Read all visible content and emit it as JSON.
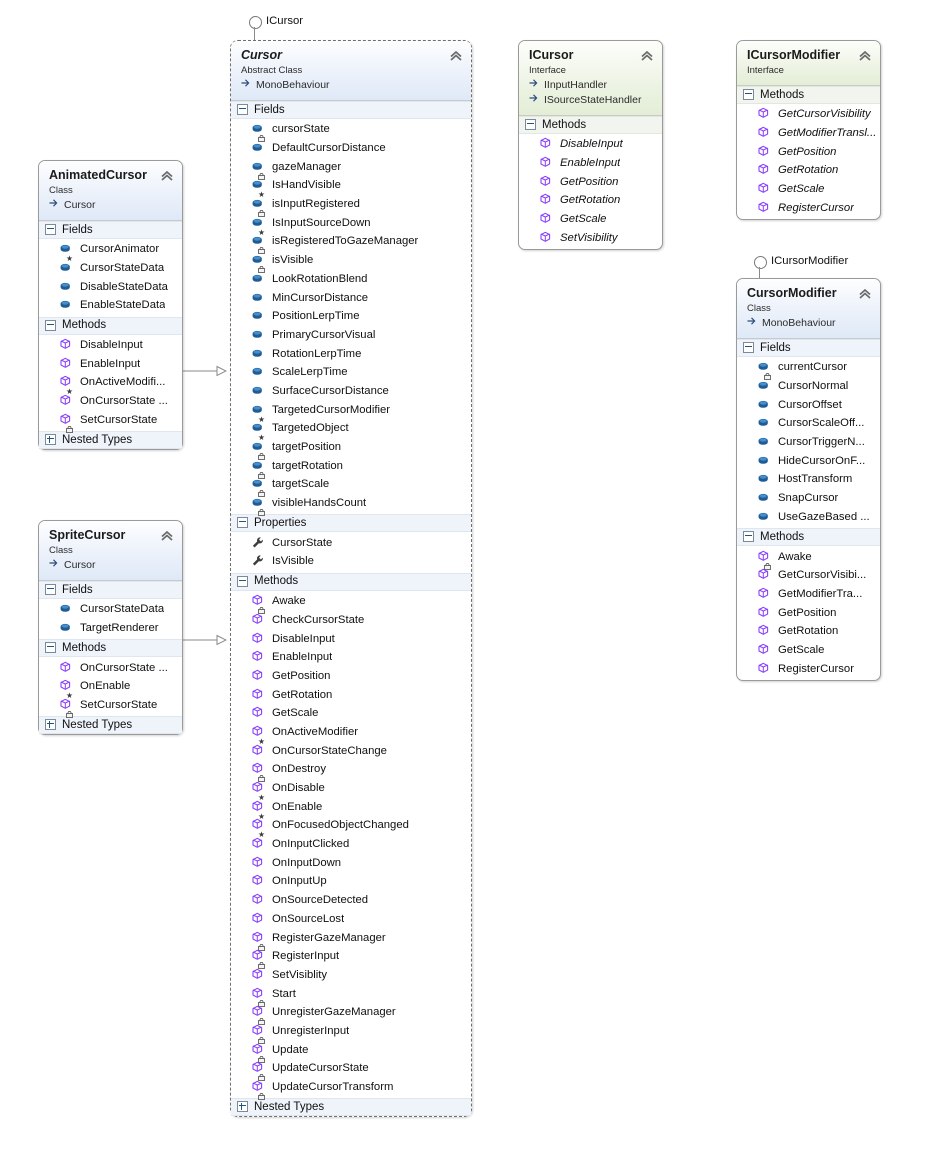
{
  "diagram": {
    "title": "Class Diagram",
    "icons": {
      "collapse": "chevron-up-icon",
      "expand_section": "plus-box-icon",
      "collapse_section": "minus-box-icon",
      "field": "field-icon",
      "property": "property-wrench-icon",
      "method": "method-cube-icon",
      "private": "lock-badge",
      "protected": "key-badge",
      "interface_lollipop": "lollipop-icon",
      "inheritance_arrow": "hollow-triangle-arrow"
    },
    "colors": {
      "class_header": "#dfe9f7",
      "interface_header": "#e3eed6",
      "section_row": "#eff3fa",
      "field_icon": "#2e75b6",
      "method_icon": "#8a3ffc",
      "property_icon": "#3d3d3d",
      "connector": "#8a8a8a",
      "border": "#9a9a9a"
    }
  },
  "lollipops": [
    {
      "label": "ICursor",
      "target": "Cursor"
    },
    {
      "label": "ICursorModifier",
      "target": "CursorModifier"
    }
  ],
  "classes": {
    "animated_cursor": {
      "name": "AnimatedCursor",
      "kind": "Class",
      "base": "Cursor",
      "abstract": false,
      "sections": [
        {
          "label": "Fields",
          "expanded": true,
          "members": [
            {
              "name": "CursorAnimator",
              "icon": "field",
              "modifier": "protected"
            },
            {
              "name": "CursorStateData",
              "icon": "field",
              "modifier": "public"
            },
            {
              "name": "DisableStateData",
              "icon": "field",
              "modifier": "public"
            },
            {
              "name": "EnableStateData",
              "icon": "field",
              "modifier": "public"
            }
          ]
        },
        {
          "label": "Methods",
          "expanded": true,
          "members": [
            {
              "name": "DisableInput",
              "icon": "method",
              "modifier": "public"
            },
            {
              "name": "EnableInput",
              "icon": "method",
              "modifier": "public"
            },
            {
              "name": "OnActiveModifi...",
              "icon": "method",
              "modifier": "protected"
            },
            {
              "name": "OnCursorState ...",
              "icon": "method",
              "modifier": "public"
            },
            {
              "name": "SetCursorState",
              "icon": "method",
              "modifier": "private"
            }
          ]
        },
        {
          "label": "Nested Types",
          "expanded": false,
          "members": []
        }
      ]
    },
    "sprite_cursor": {
      "name": "SpriteCursor",
      "kind": "Class",
      "base": "Cursor",
      "abstract": false,
      "sections": [
        {
          "label": "Fields",
          "expanded": true,
          "members": [
            {
              "name": "CursorStateData",
              "icon": "field",
              "modifier": "public"
            },
            {
              "name": "TargetRenderer",
              "icon": "field",
              "modifier": "public"
            }
          ]
        },
        {
          "label": "Methods",
          "expanded": true,
          "members": [
            {
              "name": "OnCursorState ...",
              "icon": "method",
              "modifier": "public"
            },
            {
              "name": "OnEnable",
              "icon": "method",
              "modifier": "protected"
            },
            {
              "name": "SetCursorState",
              "icon": "method",
              "modifier": "private"
            }
          ]
        },
        {
          "label": "Nested Types",
          "expanded": false,
          "members": []
        }
      ]
    },
    "cursor": {
      "name": "Cursor",
      "kind": "Abstract Class",
      "base": "MonoBehaviour",
      "abstract": true,
      "selected": true,
      "sections": [
        {
          "label": "Fields",
          "expanded": true,
          "members": [
            {
              "name": "cursorState",
              "icon": "field",
              "modifier": "private"
            },
            {
              "name": "DefaultCursorDistance",
              "icon": "field",
              "modifier": "public"
            },
            {
              "name": "gazeManager",
              "icon": "field",
              "modifier": "private"
            },
            {
              "name": "IsHandVisible",
              "icon": "field",
              "modifier": "protected"
            },
            {
              "name": "isInputRegistered",
              "icon": "field",
              "modifier": "private"
            },
            {
              "name": "IsInputSourceDown",
              "icon": "field",
              "modifier": "protected"
            },
            {
              "name": "isRegisteredToGazeManager",
              "icon": "field",
              "modifier": "private"
            },
            {
              "name": "isVisible",
              "icon": "field",
              "modifier": "private"
            },
            {
              "name": "LookRotationBlend",
              "icon": "field",
              "modifier": "public"
            },
            {
              "name": "MinCursorDistance",
              "icon": "field",
              "modifier": "public"
            },
            {
              "name": "PositionLerpTime",
              "icon": "field",
              "modifier": "public"
            },
            {
              "name": "PrimaryCursorVisual",
              "icon": "field",
              "modifier": "public"
            },
            {
              "name": "RotationLerpTime",
              "icon": "field",
              "modifier": "public"
            },
            {
              "name": "ScaleLerpTime",
              "icon": "field",
              "modifier": "public"
            },
            {
              "name": "SurfaceCursorDistance",
              "icon": "field",
              "modifier": "public"
            },
            {
              "name": "TargetedCursorModifier",
              "icon": "field",
              "modifier": "protected"
            },
            {
              "name": "TargetedObject",
              "icon": "field",
              "modifier": "protected"
            },
            {
              "name": "targetPosition",
              "icon": "field",
              "modifier": "private"
            },
            {
              "name": "targetRotation",
              "icon": "field",
              "modifier": "private"
            },
            {
              "name": "targetScale",
              "icon": "field",
              "modifier": "private"
            },
            {
              "name": "visibleHandsCount",
              "icon": "field",
              "modifier": "private"
            }
          ]
        },
        {
          "label": "Properties",
          "expanded": true,
          "members": [
            {
              "name": "CursorState",
              "icon": "property",
              "modifier": "public"
            },
            {
              "name": "IsVisible",
              "icon": "property",
              "modifier": "public"
            }
          ]
        },
        {
          "label": "Methods",
          "expanded": true,
          "members": [
            {
              "name": "Awake",
              "icon": "method",
              "modifier": "private"
            },
            {
              "name": "CheckCursorState",
              "icon": "method",
              "modifier": "public"
            },
            {
              "name": "DisableInput",
              "icon": "method",
              "modifier": "public"
            },
            {
              "name": "EnableInput",
              "icon": "method",
              "modifier": "public"
            },
            {
              "name": "GetPosition",
              "icon": "method",
              "modifier": "public"
            },
            {
              "name": "GetRotation",
              "icon": "method",
              "modifier": "public"
            },
            {
              "name": "GetScale",
              "icon": "method",
              "modifier": "public"
            },
            {
              "name": "OnActiveModifier",
              "icon": "method",
              "modifier": "protected"
            },
            {
              "name": "OnCursorStateChange",
              "icon": "method",
              "modifier": "public"
            },
            {
              "name": "OnDestroy",
              "icon": "method",
              "modifier": "private"
            },
            {
              "name": "OnDisable",
              "icon": "method",
              "modifier": "protected"
            },
            {
              "name": "OnEnable",
              "icon": "method",
              "modifier": "protected"
            },
            {
              "name": "OnFocusedObjectChanged",
              "icon": "method",
              "modifier": "protected"
            },
            {
              "name": "OnInputClicked",
              "icon": "method",
              "modifier": "public"
            },
            {
              "name": "OnInputDown",
              "icon": "method",
              "modifier": "public"
            },
            {
              "name": "OnInputUp",
              "icon": "method",
              "modifier": "public"
            },
            {
              "name": "OnSourceDetected",
              "icon": "method",
              "modifier": "public"
            },
            {
              "name": "OnSourceLost",
              "icon": "method",
              "modifier": "public"
            },
            {
              "name": "RegisterGazeManager",
              "icon": "method",
              "modifier": "private"
            },
            {
              "name": "RegisterInput",
              "icon": "method",
              "modifier": "private"
            },
            {
              "name": "SetVisiblity",
              "icon": "method",
              "modifier": "public"
            },
            {
              "name": "Start",
              "icon": "method",
              "modifier": "private"
            },
            {
              "name": "UnregisterGazeManager",
              "icon": "method",
              "modifier": "private"
            },
            {
              "name": "UnregisterInput",
              "icon": "method",
              "modifier": "private"
            },
            {
              "name": "Update",
              "icon": "method",
              "modifier": "private"
            },
            {
              "name": "UpdateCursorState",
              "icon": "method",
              "modifier": "private"
            },
            {
              "name": "UpdateCursorTransform",
              "icon": "method",
              "modifier": "private"
            }
          ]
        },
        {
          "label": "Nested Types",
          "expanded": false,
          "members": []
        }
      ]
    },
    "icursor": {
      "name": "ICursor",
      "kind": "Interface",
      "bases": [
        "IInputHandler",
        "ISourceStateHandler"
      ],
      "sections": [
        {
          "label": "Methods",
          "expanded": true,
          "members": [
            {
              "name": "DisableInput",
              "icon": "method",
              "modifier": "public",
              "italic": true
            },
            {
              "name": "EnableInput",
              "icon": "method",
              "modifier": "public",
              "italic": true
            },
            {
              "name": "GetPosition",
              "icon": "method",
              "modifier": "public",
              "italic": true
            },
            {
              "name": "GetRotation",
              "icon": "method",
              "modifier": "public",
              "italic": true
            },
            {
              "name": "GetScale",
              "icon": "method",
              "modifier": "public",
              "italic": true
            },
            {
              "name": "SetVisibility",
              "icon": "method",
              "modifier": "public",
              "italic": true
            }
          ]
        }
      ]
    },
    "icursormodifier": {
      "name": "ICursorModifier",
      "kind": "Interface",
      "bases": [],
      "sections": [
        {
          "label": "Methods",
          "expanded": true,
          "members": [
            {
              "name": "GetCursorVisibility",
              "icon": "method",
              "modifier": "public",
              "italic": true
            },
            {
              "name": "GetModifierTransl...",
              "icon": "method",
              "modifier": "public",
              "italic": true
            },
            {
              "name": "GetPosition",
              "icon": "method",
              "modifier": "public",
              "italic": true
            },
            {
              "name": "GetRotation",
              "icon": "method",
              "modifier": "public",
              "italic": true
            },
            {
              "name": "GetScale",
              "icon": "method",
              "modifier": "public",
              "italic": true
            },
            {
              "name": "RegisterCursor",
              "icon": "method",
              "modifier": "public",
              "italic": true
            }
          ]
        }
      ]
    },
    "cursor_modifier": {
      "name": "CursorModifier",
      "kind": "Class",
      "base": "MonoBehaviour",
      "abstract": false,
      "sections": [
        {
          "label": "Fields",
          "expanded": true,
          "members": [
            {
              "name": "currentCursor",
              "icon": "field",
              "modifier": "private"
            },
            {
              "name": "CursorNormal",
              "icon": "field",
              "modifier": "public"
            },
            {
              "name": "CursorOffset",
              "icon": "field",
              "modifier": "public"
            },
            {
              "name": "CursorScaleOff...",
              "icon": "field",
              "modifier": "public"
            },
            {
              "name": "CursorTriggerN...",
              "icon": "field",
              "modifier": "public"
            },
            {
              "name": "HideCursorOnF...",
              "icon": "field",
              "modifier": "public"
            },
            {
              "name": "HostTransform",
              "icon": "field",
              "modifier": "public"
            },
            {
              "name": "SnapCursor",
              "icon": "field",
              "modifier": "public"
            },
            {
              "name": "UseGazeBased ...",
              "icon": "field",
              "modifier": "public"
            }
          ]
        },
        {
          "label": "Methods",
          "expanded": true,
          "members": [
            {
              "name": "Awake",
              "icon": "method",
              "modifier": "private"
            },
            {
              "name": "GetCursorVisibi...",
              "icon": "method",
              "modifier": "public"
            },
            {
              "name": "GetModifierTra...",
              "icon": "method",
              "modifier": "public"
            },
            {
              "name": "GetPosition",
              "icon": "method",
              "modifier": "public"
            },
            {
              "name": "GetRotation",
              "icon": "method",
              "modifier": "public"
            },
            {
              "name": "GetScale",
              "icon": "method",
              "modifier": "public"
            },
            {
              "name": "RegisterCursor",
              "icon": "method",
              "modifier": "public"
            }
          ]
        }
      ]
    }
  }
}
